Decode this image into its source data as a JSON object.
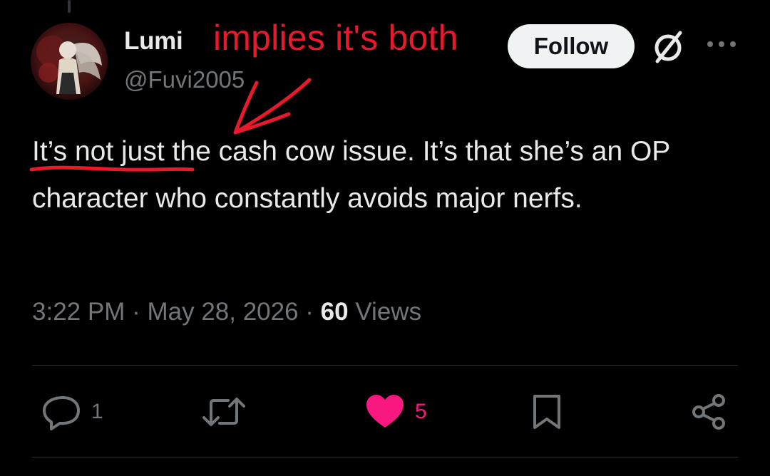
{
  "author": {
    "display_name": "Lumi",
    "handle": "@Fuvi2005"
  },
  "follow_label": "Follow",
  "annotation": {
    "text": "implies it's both",
    "color": "#e8192c"
  },
  "tweet": {
    "text_part1": "It’s not just",
    "text_part2": " the cash cow issue. It’s that she’s an OP character who constantly avoids major nerfs."
  },
  "meta": {
    "time": "3:22 PM",
    "separator": " · ",
    "date": "May 28, 2026",
    "views_count": "60",
    "views_label": "Views"
  },
  "actions": {
    "replies": "1",
    "reposts": "",
    "likes": "5",
    "liked": true,
    "like_color": "#f91880"
  },
  "icons": [
    "grok-icon",
    "more-icon",
    "reply-icon",
    "repost-icon",
    "heart-icon",
    "bookmark-icon",
    "share-icon"
  ],
  "colors": {
    "background": "#000000",
    "text": "#e7e9ea",
    "secondary": "#71767b",
    "follow_bg": "#eff3f4"
  }
}
